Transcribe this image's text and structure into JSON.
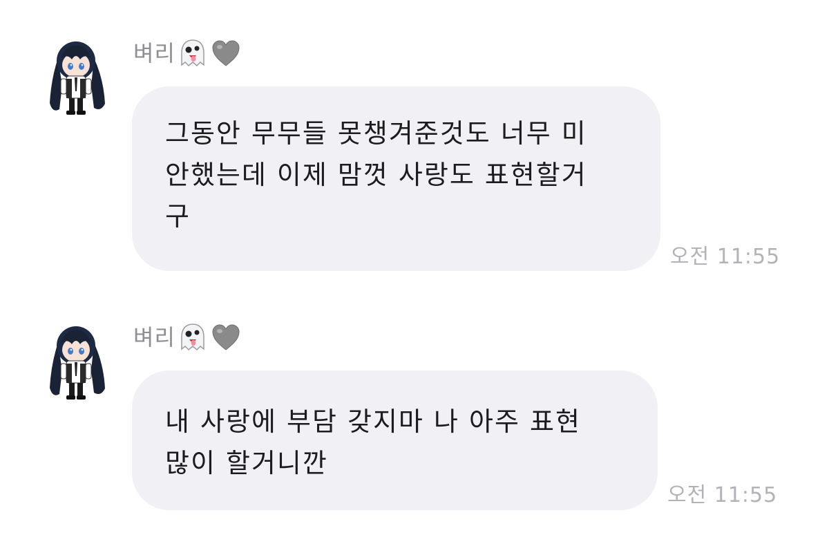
{
  "messages": [
    {
      "sender": "벼리",
      "sender_icons": [
        "ghost-icon",
        "gray-heart-icon"
      ],
      "text": "그동안 무무들 못챙겨준것도 너무 미\n안했는데 이제 맘껏 사랑도 표현할거\n구",
      "time": "오전 11:55"
    },
    {
      "sender": "벼리",
      "sender_icons": [
        "ghost-icon",
        "gray-heart-icon"
      ],
      "text": "내 사랑에 부담 갖지마 나 아주 표현\n많이 할거니깐",
      "time": "오전 11:55"
    }
  ],
  "colors": {
    "bubble": "#f1f1f5",
    "sender_text": "#8e8e93",
    "timestamp_text": "#b2b2b8",
    "message_text": "#1c1c1e",
    "heart": "#8a8a8a"
  }
}
